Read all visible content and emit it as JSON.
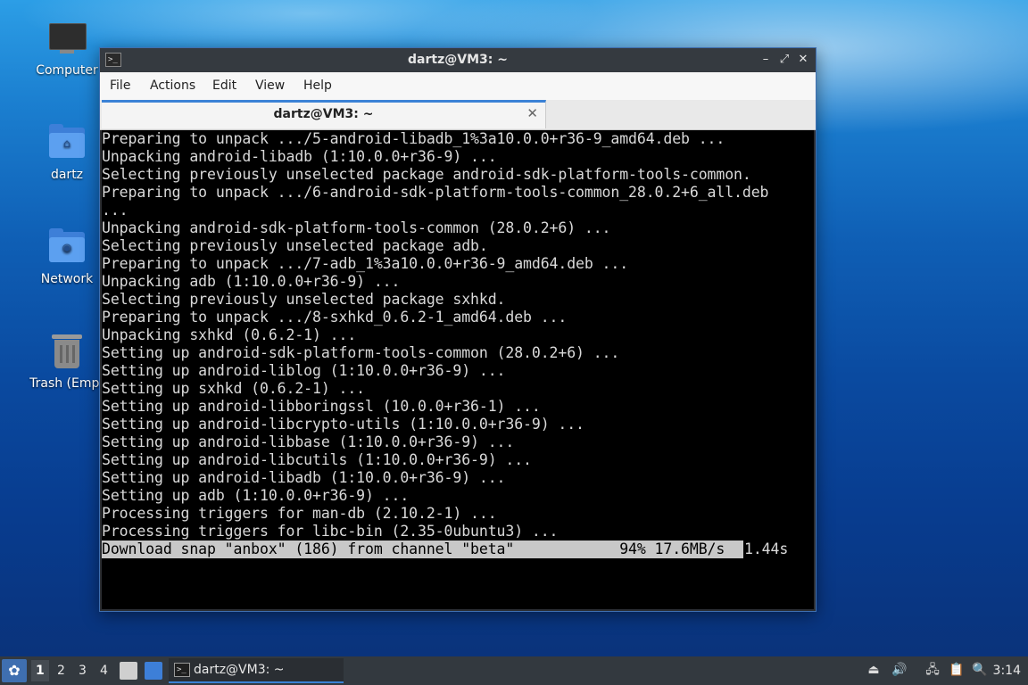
{
  "desktop": {
    "icons": [
      {
        "label": "Computer"
      },
      {
        "label": "dartz"
      },
      {
        "label": "Network"
      },
      {
        "label": "Trash (Empt"
      }
    ]
  },
  "window": {
    "title": "dartz@VM3: ~",
    "controls": {
      "minimize": "–",
      "maximize": "⤢",
      "close": "✕"
    },
    "menu": {
      "file": "File",
      "actions": "Actions",
      "edit": "Edit",
      "view": "View",
      "help": "Help"
    },
    "tab": {
      "title": "dartz@VM3: ~",
      "close": "✕"
    }
  },
  "terminal": {
    "lines": [
      "Preparing to unpack .../5-android-libadb_1%3a10.0.0+r36-9_amd64.deb ...",
      "Unpacking android-libadb (1:10.0.0+r36-9) ...",
      "Selecting previously unselected package android-sdk-platform-tools-common.",
      "Preparing to unpack .../6-android-sdk-platform-tools-common_28.0.2+6_all.deb",
      "...",
      "Unpacking android-sdk-platform-tools-common (28.0.2+6) ...",
      "Selecting previously unselected package adb.",
      "Preparing to unpack .../7-adb_1%3a10.0.0+r36-9_amd64.deb ...",
      "Unpacking adb (1:10.0.0+r36-9) ...",
      "Selecting previously unselected package sxhkd.",
      "Preparing to unpack .../8-sxhkd_0.6.2-1_amd64.deb ...",
      "Unpacking sxhkd (0.6.2-1) ...",
      "Setting up android-sdk-platform-tools-common (28.0.2+6) ...",
      "Setting up android-liblog (1:10.0.0+r36-9) ...",
      "Setting up sxhkd (0.6.2-1) ...",
      "Setting up android-libboringssl (10.0.0+r36-1) ...",
      "Setting up android-libcrypto-utils (1:10.0.0+r36-9) ...",
      "Setting up android-libbase (1:10.0.0+r36-9) ...",
      "Setting up android-libcutils (1:10.0.0+r36-9) ...",
      "Setting up android-libadb (1:10.0.0+r36-9) ...",
      "Setting up adb (1:10.0.0+r36-9) ...",
      "Processing triggers for man-db (2.10.2-1) ...",
      "Processing triggers for libc-bin (2.35-0ubuntu3) ..."
    ],
    "progress": {
      "text": "Download snap \"anbox\" (186) from channel \"beta\"            94% 17.6MB/s",
      "remaining": "1.44s"
    }
  },
  "taskbar": {
    "start_icon": "whisker-menu-icon",
    "workspaces": [
      "1",
      "2",
      "3",
      "4"
    ],
    "task_label": "dartz@VM3: ~",
    "clock": "3:14"
  },
  "colors": {
    "accent": "#3b82d6",
    "terminal_bg": "#000000",
    "terminal_fg": "#d9d9d9",
    "progress_bg": "#c8c8c8"
  }
}
